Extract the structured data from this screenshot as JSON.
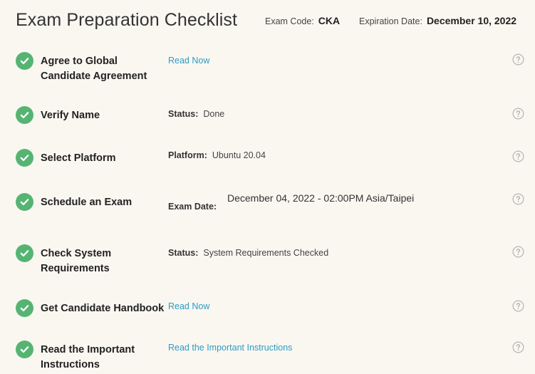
{
  "header": {
    "title": "Exam Preparation Checklist",
    "exam_code_label": "Exam Code:",
    "exam_code_value": "CKA",
    "expiration_label": "Expiration Date:",
    "expiration_value": "December 10, 2022"
  },
  "steps": [
    {
      "name": "Agree to Global Candidate Agreement",
      "link": "Read Now",
      "status": "complete"
    },
    {
      "name": "Verify Name",
      "detail_label": "Status:",
      "detail_value": "Done",
      "status": "complete"
    },
    {
      "name": "Select Platform",
      "detail_label": "Platform:",
      "detail_value": "Ubuntu 20.04",
      "status": "complete"
    },
    {
      "name": "Schedule an Exam",
      "detail_label": "Exam Date:",
      "detail_value": "December 04, 2022 - 02:00PM Asia/Taipei",
      "status": "complete"
    },
    {
      "name": "Check System Requirements",
      "detail_label": "Status:",
      "detail_value": "System Requirements Checked",
      "status": "complete"
    },
    {
      "name": "Get Candidate Handbook",
      "link": "Read Now",
      "status": "complete"
    },
    {
      "name": "Read the Important Instructions",
      "link": "Read the Important Instructions",
      "status": "complete"
    }
  ],
  "colors": {
    "background": "#faf7f1",
    "check_green": "#56b473",
    "link_blue": "#2e9bc4",
    "help_gray": "#b5b5b5"
  },
  "icons": {
    "check": "check-circle-icon",
    "help": "help-circle-icon"
  }
}
